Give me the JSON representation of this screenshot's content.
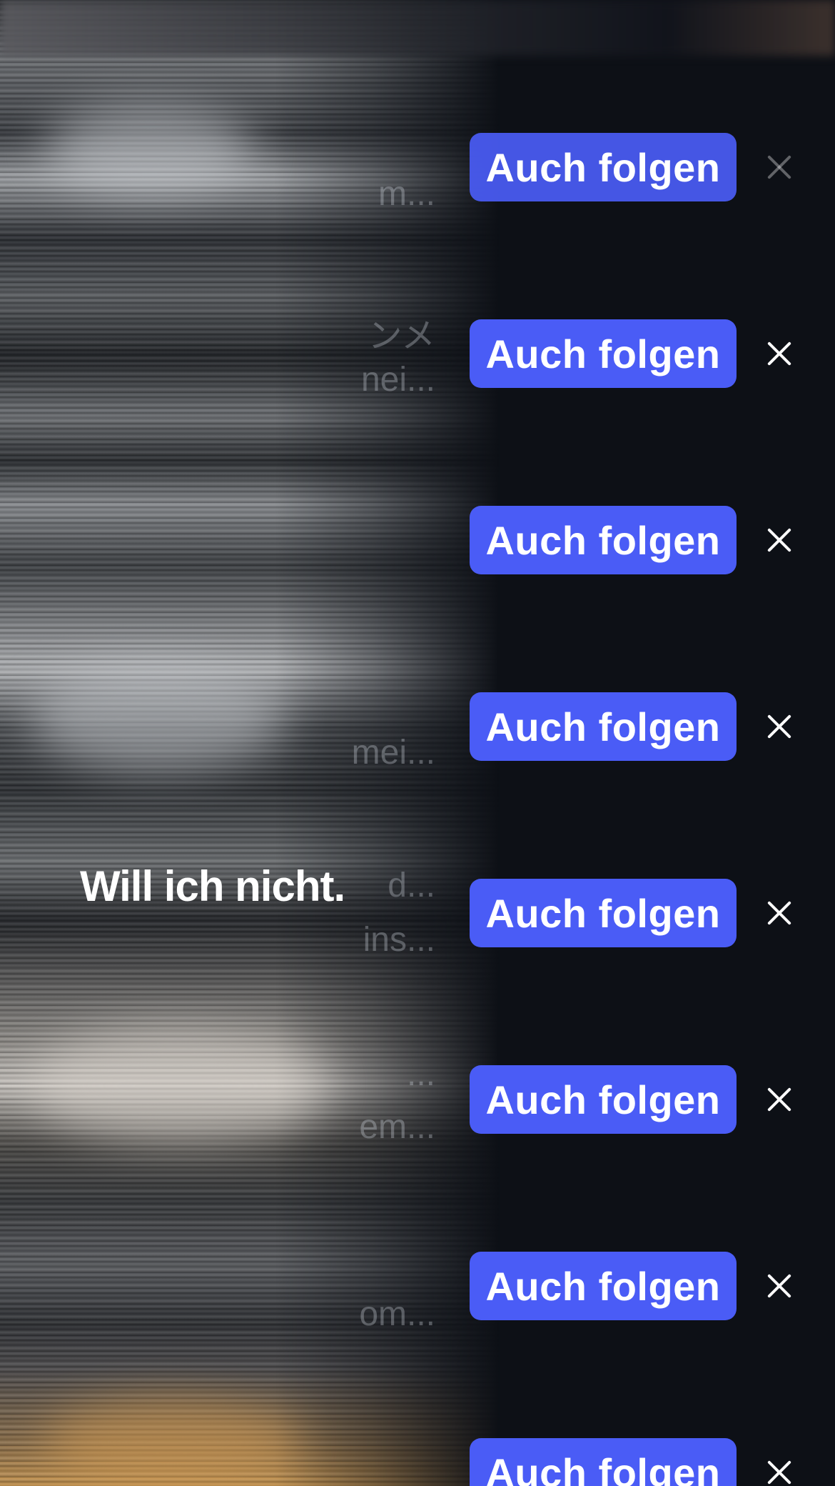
{
  "rows": [
    {
      "button_label": "Auch folgen",
      "faded_line_1": "",
      "faded_line_2": "m..."
    },
    {
      "button_label": "Auch folgen",
      "faded_line_1": "ンメ",
      "faded_line_2": "nei..."
    },
    {
      "button_label": "Auch folgen",
      "faded_line_1": "",
      "faded_line_2": ""
    },
    {
      "button_label": "Auch folgen",
      "faded_line_1": "",
      "faded_line_2": "mei..."
    },
    {
      "button_label": "Auch folgen",
      "faded_line_1": "d...",
      "faded_line_2": "ins..."
    },
    {
      "button_label": "Auch folgen",
      "faded_line_1": "...",
      "faded_line_2": "em..."
    },
    {
      "button_label": "Auch folgen",
      "faded_line_1": "",
      "faded_line_2": "om..."
    },
    {
      "button_label": "Auch folgen",
      "faded_line_1": "",
      "faded_line_2": ""
    }
  ],
  "toast": {
    "text": "Will ich nicht."
  },
  "icons": {
    "dismiss": "close-icon"
  },
  "colors": {
    "accent": "#4a5cf6",
    "background": "#0d1016"
  }
}
